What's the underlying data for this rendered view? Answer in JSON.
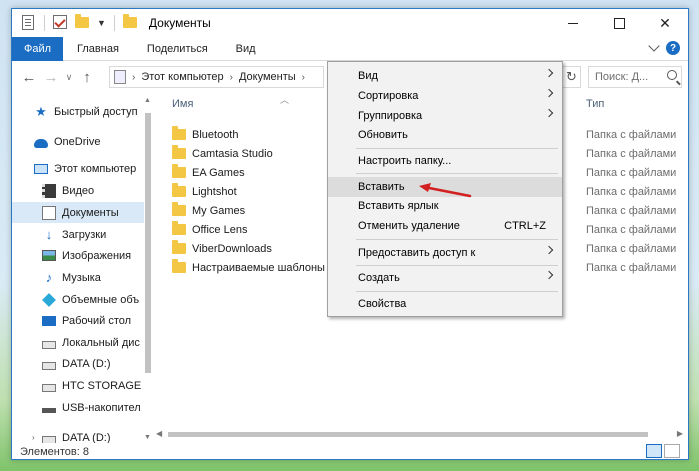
{
  "window": {
    "title": "Документы"
  },
  "ribbon": {
    "tabs": [
      "Файл",
      "Главная",
      "Поделиться",
      "Вид"
    ]
  },
  "address": {
    "crumbs": [
      "Этот компьютер",
      "Документы"
    ],
    "search_placeholder": "Поиск: Д..."
  },
  "nav": {
    "items": [
      {
        "label": "Быстрый доступ",
        "icon": "star-icon"
      },
      {
        "label": "OneDrive",
        "icon": "cloud-icon"
      },
      {
        "label": "Этот компьютер",
        "icon": "computer-icon"
      },
      {
        "label": "Видео",
        "icon": "video-icon"
      },
      {
        "label": "Документы",
        "icon": "document-icon",
        "selected": true
      },
      {
        "label": "Загрузки",
        "icon": "download-icon"
      },
      {
        "label": "Изображения",
        "icon": "images-icon"
      },
      {
        "label": "Музыка",
        "icon": "music-icon"
      },
      {
        "label": "Объемные объ",
        "icon": "3d-objects-icon"
      },
      {
        "label": "Рабочий стол",
        "icon": "desktop-icon"
      },
      {
        "label": "Локальный дис",
        "icon": "local-disk-icon"
      },
      {
        "label": "DATA (D:)",
        "icon": "drive-icon"
      },
      {
        "label": "HTC STORAGE (",
        "icon": "drive-icon"
      },
      {
        "label": "USB-накопител",
        "icon": "usb-icon"
      },
      {
        "label": "DATA (D:)",
        "icon": "drive-icon"
      }
    ]
  },
  "files": {
    "col_name": "Имя",
    "col_type": "Тип",
    "rows": [
      {
        "name": "Bluetooth",
        "type": "Папка с файлами"
      },
      {
        "name": "Camtasia Studio",
        "type": "Папка с файлами"
      },
      {
        "name": "EA Games",
        "type": "Папка с файлами"
      },
      {
        "name": "Lightshot",
        "type": "Папка с файлами"
      },
      {
        "name": "My Games",
        "type": "Папка с файлами"
      },
      {
        "name": "Office Lens",
        "type": "Папка с файлами"
      },
      {
        "name": "ViberDownloads",
        "type": "Папка с файлами"
      },
      {
        "name": "Настраиваемые шаблоны O",
        "type": "Папка с файлами"
      }
    ]
  },
  "context_menu": {
    "view": "Вид",
    "sort": "Сортировка",
    "group": "Группировка",
    "refresh": "Обновить",
    "customize": "Настроить папку...",
    "paste": "Вставить",
    "paste_shortcut": "Вставить ярлык",
    "undo": "Отменить удаление",
    "undo_key": "CTRL+Z",
    "share": "Предоставить доступ к",
    "new": "Создать",
    "properties": "Свойства"
  },
  "status": {
    "count": "Элементов: 8"
  },
  "colors": {
    "accent": "#1a6dc3",
    "selection": "#d9e9f7",
    "annotation_arrow": "#d21f1f"
  }
}
